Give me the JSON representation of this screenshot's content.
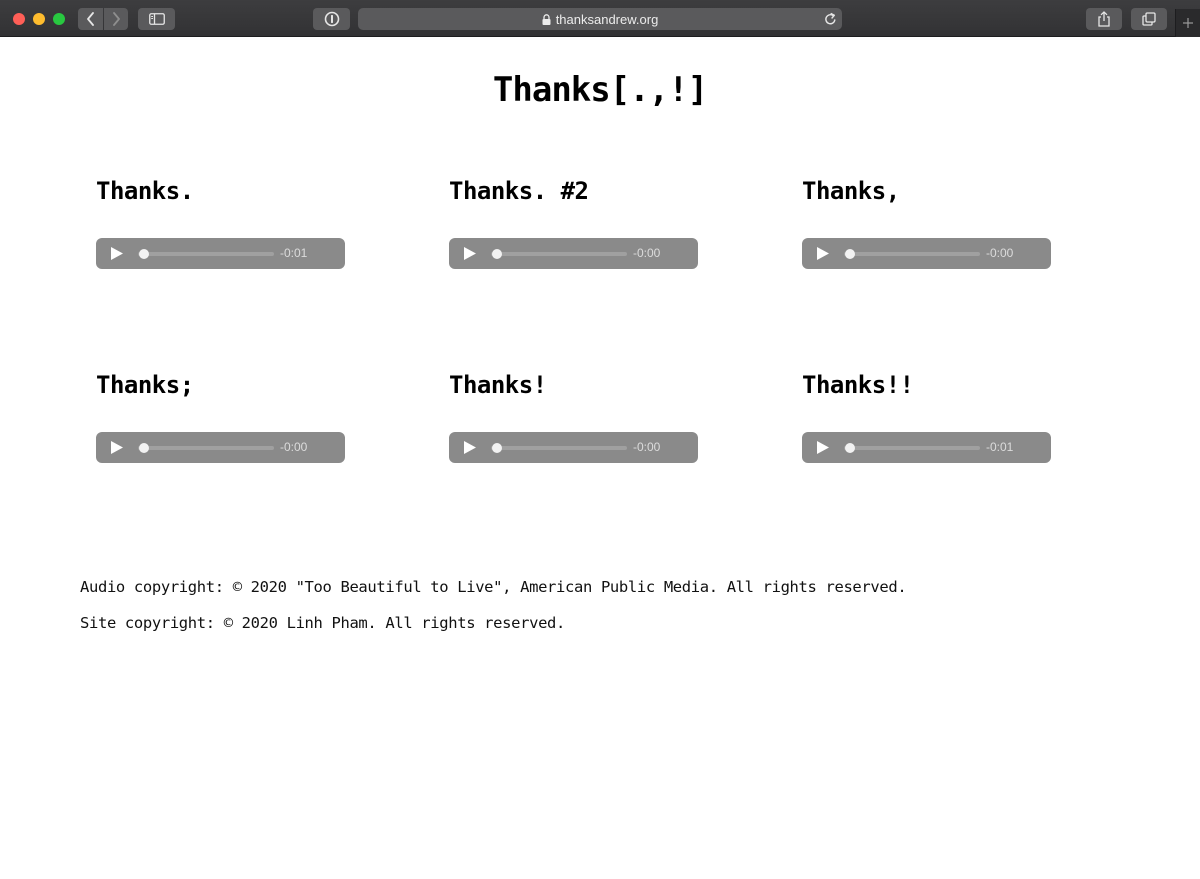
{
  "browser": {
    "url": "thanksandrew.org",
    "icons": {
      "back": "chevron-left-icon",
      "forward": "chevron-right-icon",
      "sidebar": "sidebar-icon",
      "password_manager": "1password-icon",
      "lock": "lock-icon",
      "reload": "reload-icon",
      "share": "share-icon",
      "tabs": "tabs-icon",
      "new_tab": "plus-icon"
    }
  },
  "page": {
    "title": "Thanks[.,!]",
    "clips": [
      {
        "title": "Thanks.",
        "time": "-0:01"
      },
      {
        "title": "Thanks. #2",
        "time": "-0:00"
      },
      {
        "title": "Thanks,",
        "time": "-0:00"
      },
      {
        "title": "Thanks;",
        "time": "-0:00"
      },
      {
        "title": "Thanks!",
        "time": "-0:00"
      },
      {
        "title": "Thanks!!",
        "time": "-0:01"
      }
    ],
    "footer": {
      "audio_copyright": "Audio copyright: © 2020 \"Too Beautiful to Live\", American Public Media. All rights reserved.",
      "site_copyright": "Site copyright: © 2020 Linh Pham. All rights reserved."
    }
  },
  "colors": {
    "player_bg": "#8a8a8a",
    "chrome_bg": "#3d3d3f"
  }
}
